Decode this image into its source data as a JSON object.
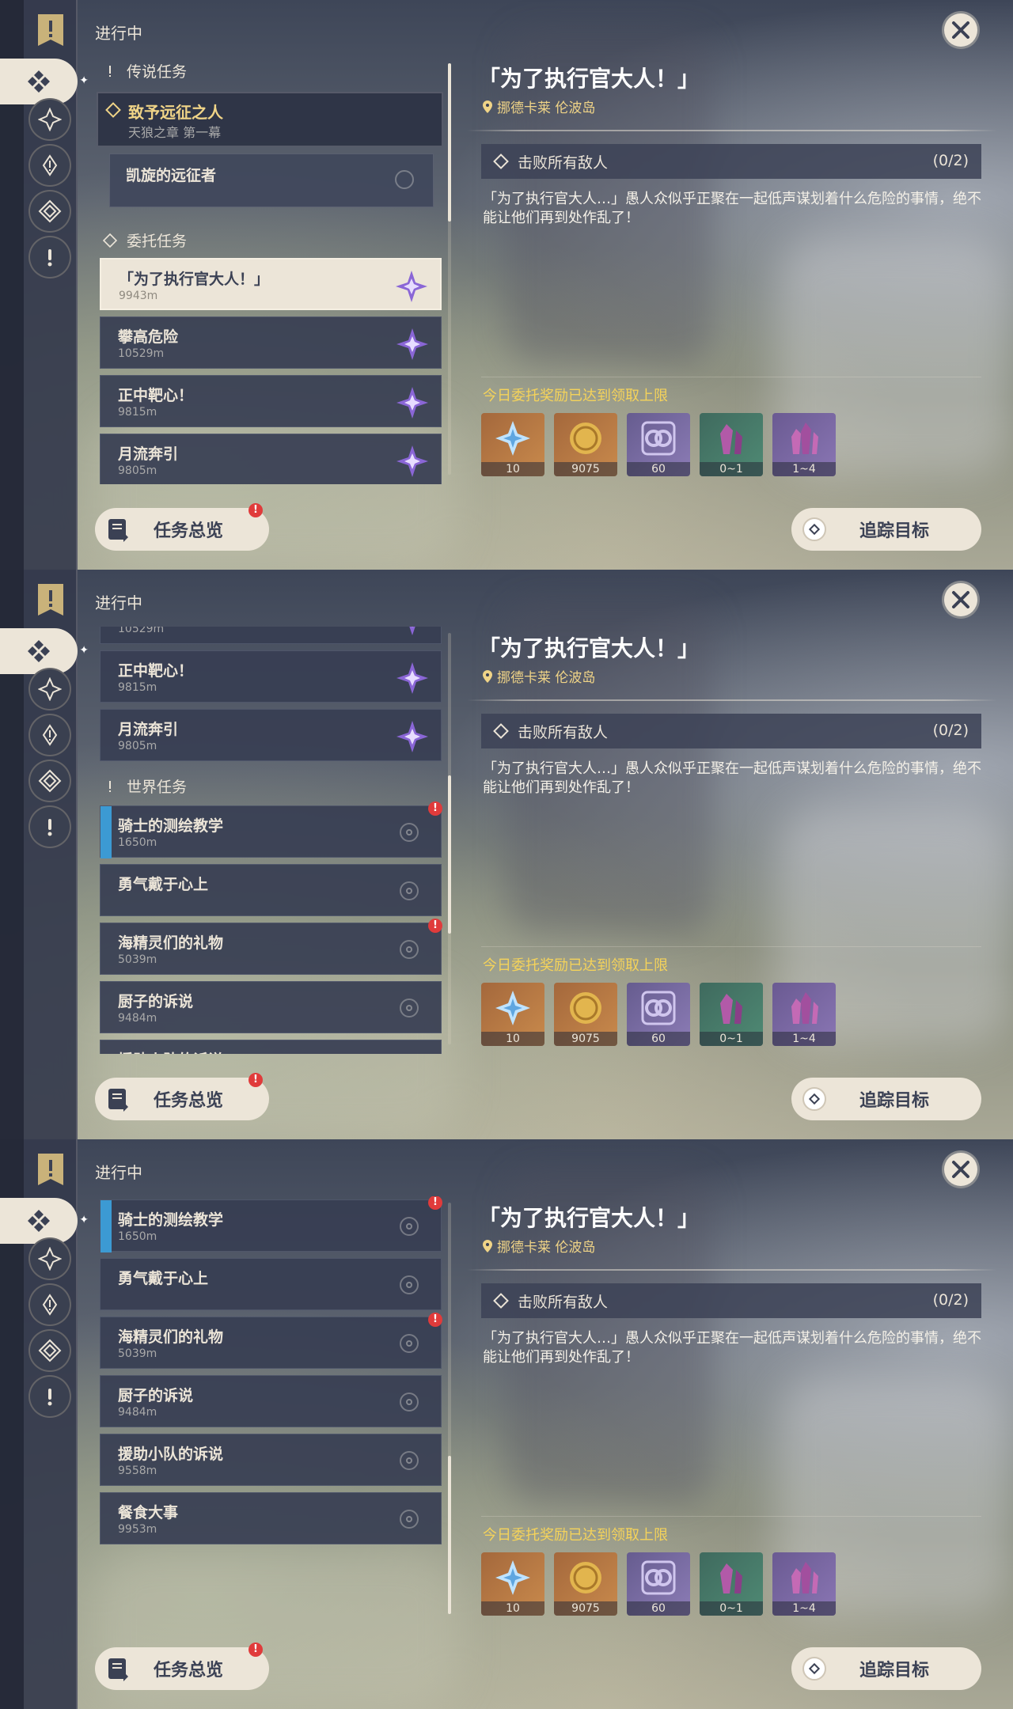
{
  "header": {
    "inprogress": "进行中"
  },
  "sections": {
    "legend": "传说任务",
    "commission": "委托任务",
    "world": "世界任务"
  },
  "legend_quest": {
    "title": "致予远征之人",
    "subtitle": "天狼之章 第一幕",
    "step": "凯旋的远征者"
  },
  "commissions": [
    {
      "title": "「为了执行官大人！」",
      "dist": "9943m"
    },
    {
      "title": "攀高危险",
      "dist": "10529m"
    },
    {
      "title": "正中靶心！",
      "dist": "9815m"
    },
    {
      "title": "月流奔引",
      "dist": "9805m"
    }
  ],
  "world_quests": [
    {
      "title": "骑士的测绘教学",
      "dist": "1650m"
    },
    {
      "title": "勇气戴于心上",
      "dist": ""
    },
    {
      "title": "海精灵们的礼物",
      "dist": "5039m"
    },
    {
      "title": "厨子的诉说",
      "dist": "9484m"
    },
    {
      "title": "援助小队的诉说",
      "dist": "9558m"
    },
    {
      "title": "餐食大事",
      "dist": "9953m"
    }
  ],
  "buttons": {
    "overview": "任务总览",
    "track": "追踪目标"
  },
  "badge": "!",
  "detail": {
    "title": "「为了执行官大人！」",
    "location": "挪德卡莱 伦波岛",
    "objective": "击败所有敌人",
    "objective_count": "(0/2)",
    "description": "「为了执行官大人…」愚人众似乎正聚在一起低声谋划着什么危险的事情，绝不能让他们再到处作乱了！",
    "limit_notice": "今日委托奖励已达到领取上限"
  },
  "rewards": [
    {
      "icon": "primogem-icon",
      "count": "10"
    },
    {
      "icon": "mora-icon",
      "count": "9075"
    },
    {
      "icon": "adventure-exp-icon",
      "count": "60"
    },
    {
      "icon": "crystal-green-icon",
      "count": "0~1"
    },
    {
      "icon": "crystal-violet-icon",
      "count": "1~4"
    }
  ],
  "colors": {
    "accent": "#f0d487",
    "highlight": "#f5d35a",
    "cream": "#ece5d8",
    "alert": "#e03b3b"
  }
}
